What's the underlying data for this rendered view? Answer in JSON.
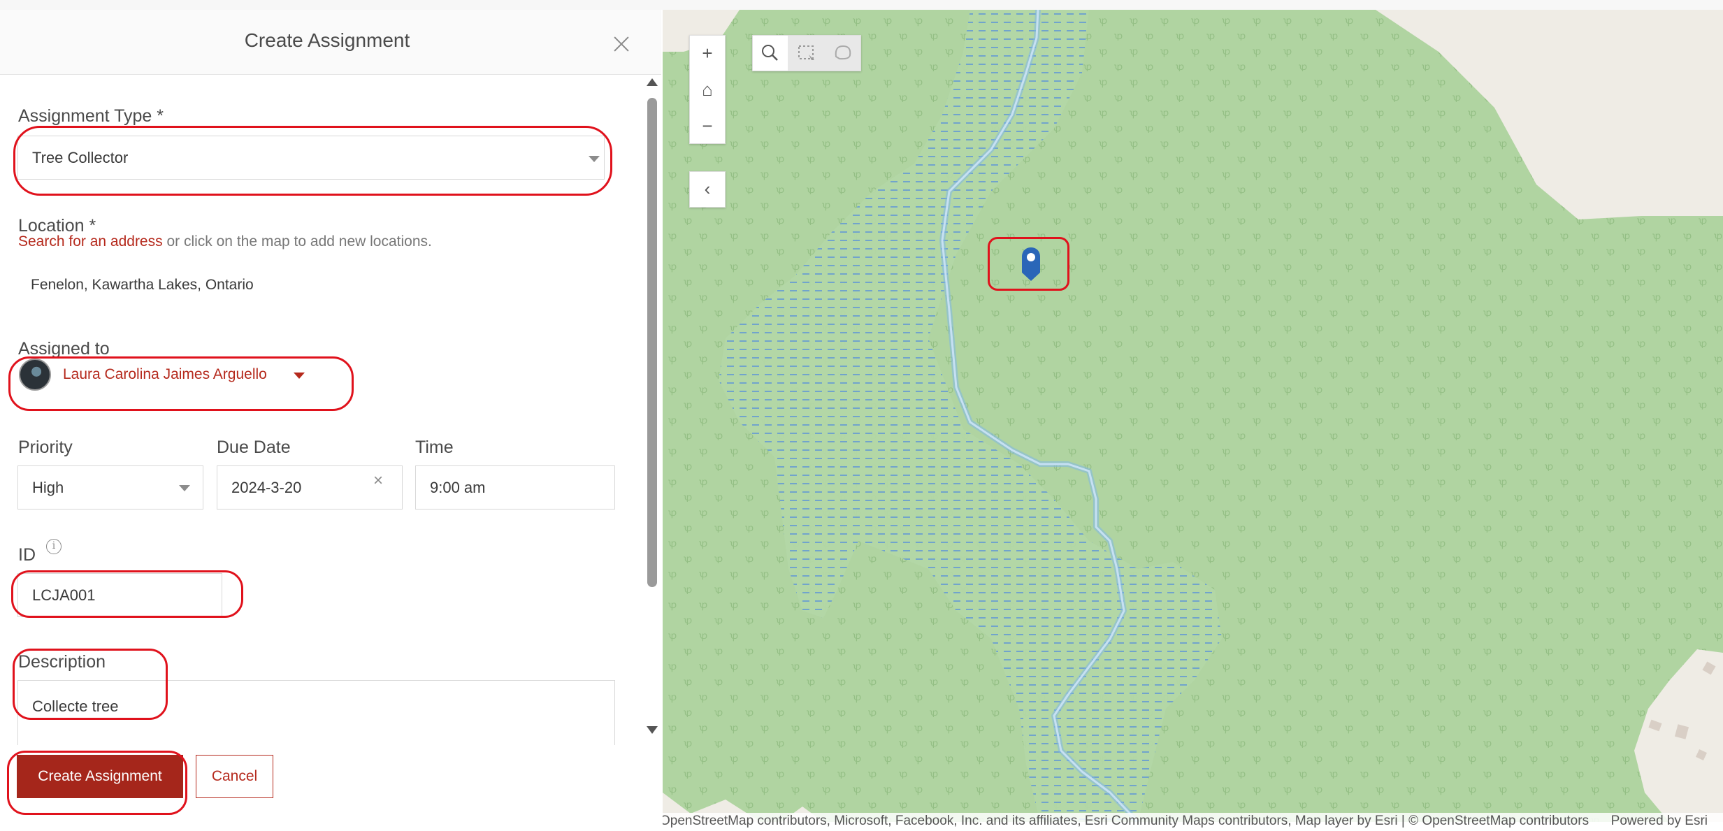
{
  "panel": {
    "title": "Create Assignment",
    "assignment_type": {
      "label": "Assignment Type  *",
      "value": "Tree Collector"
    },
    "location": {
      "label": "Location *",
      "search_link": "Search for an address",
      "hint": " or click on the map to add new locations.",
      "value": "Fenelon, Kawartha Lakes, Ontario"
    },
    "assigned_to": {
      "label": "Assigned to",
      "value": "Laura Carolina Jaimes Arguello"
    },
    "priority": {
      "label": "Priority",
      "value": "High"
    },
    "due_date": {
      "label": "Due Date",
      "value": "2024-3-20"
    },
    "time": {
      "label": "Time",
      "value": "9:00 am"
    },
    "id": {
      "label": "ID",
      "value": "LCJA001"
    },
    "description": {
      "label": "Description",
      "value": "Collecte tree"
    },
    "buttons": {
      "create": "Create Assignment",
      "cancel": "Cancel"
    }
  },
  "map": {
    "tools": {
      "zoom_in": "+",
      "home": "⌂",
      "zoom_out": "−",
      "collapse": "‹"
    },
    "attribution_left": "OpenStreetMap contributors, Microsoft, Facebook, Inc. and its affiliates, Esri Community Maps contributors, Map layer by Esri | © OpenStreetMap contributors",
    "attribution_right": "Powered by Esri"
  },
  "colors": {
    "accent": "#a5261b",
    "highlight": "#e0121c",
    "forest": "#b0d4a1",
    "wetland": "#a8cfe0",
    "marker": "#2a66b8"
  }
}
